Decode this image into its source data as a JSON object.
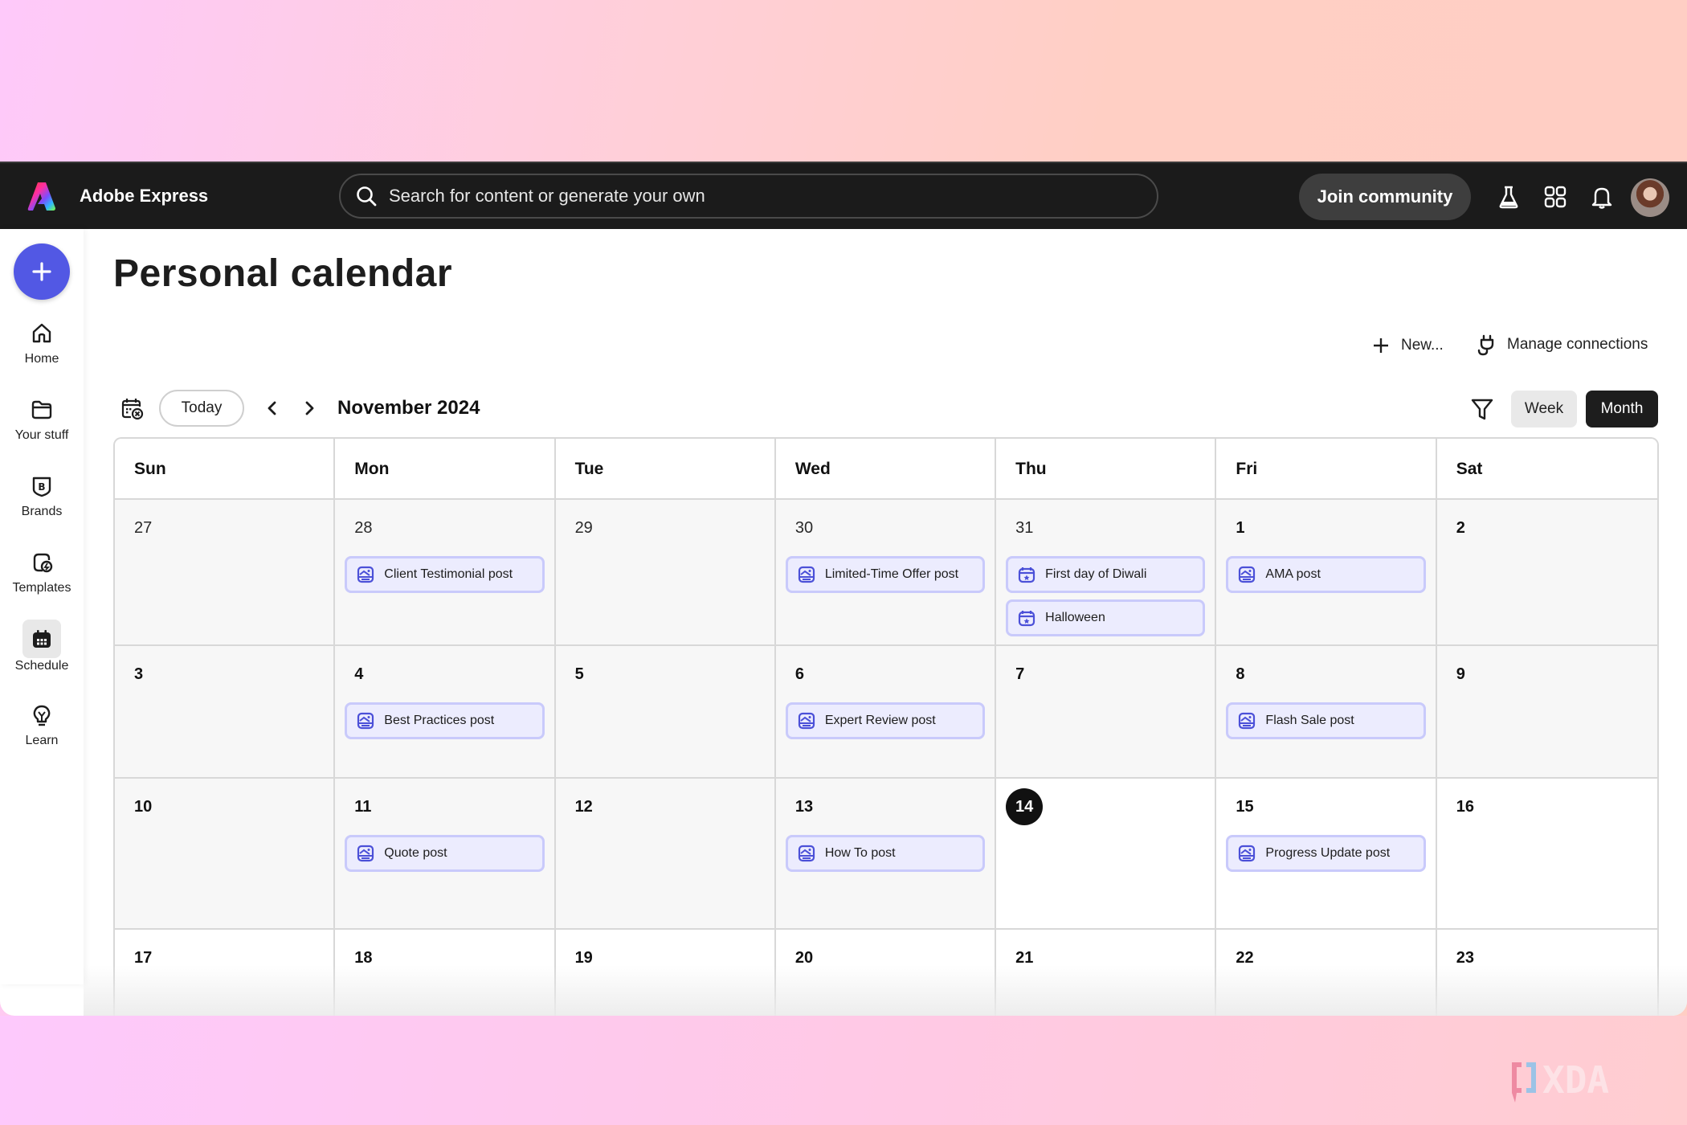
{
  "app": {
    "name": "Adobe Express",
    "search_placeholder": "Search for content or generate your own",
    "join_label": "Join community",
    "topbar_icons": [
      "labs-flask-icon",
      "apps-grid-icon",
      "notifications-bell-icon",
      "user-avatar"
    ]
  },
  "sidebar": {
    "create_icon": "plus-icon",
    "items": [
      {
        "label": "Home",
        "icon": "home-icon",
        "active": false
      },
      {
        "label": "Your stuff",
        "icon": "folder-icon",
        "active": false
      },
      {
        "label": "Brands",
        "icon": "brand-icon",
        "active": false
      },
      {
        "label": "Templates",
        "icon": "templates-icon",
        "active": false
      },
      {
        "label": "Schedule",
        "icon": "calendar-icon",
        "active": true
      },
      {
        "label": "Learn",
        "icon": "lightbulb-icon",
        "active": false
      }
    ]
  },
  "page": {
    "title": "Personal calendar",
    "new_label": "New...",
    "manage_label": "Manage connections"
  },
  "toolbar": {
    "today_label": "Today",
    "month_label": "November 2024",
    "week_label": "Week",
    "month_view_label": "Month",
    "active_view": "Month"
  },
  "calendar": {
    "weekdays": [
      "Sun",
      "Mon",
      "Tue",
      "Wed",
      "Thu",
      "Fri",
      "Sat"
    ],
    "today": "14",
    "weeks": [
      [
        {
          "day": "27",
          "other_month": true,
          "events": []
        },
        {
          "day": "28",
          "other_month": true,
          "events": [
            {
              "title": "Client Testimonial post",
              "type": "post"
            }
          ]
        },
        {
          "day": "29",
          "other_month": true,
          "events": []
        },
        {
          "day": "30",
          "other_month": true,
          "events": [
            {
              "title": "Limited-Time Offer post",
              "type": "post"
            }
          ]
        },
        {
          "day": "31",
          "other_month": true,
          "events": [
            {
              "title": "First day of Diwali",
              "type": "holiday"
            },
            {
              "title": "Halloween",
              "type": "holiday"
            }
          ]
        },
        {
          "day": "1",
          "other_month": false,
          "events": [
            {
              "title": "AMA post",
              "type": "post"
            }
          ]
        },
        {
          "day": "2",
          "other_month": false,
          "events": []
        }
      ],
      [
        {
          "day": "3",
          "other_month": false,
          "events": []
        },
        {
          "day": "4",
          "other_month": false,
          "events": [
            {
              "title": "Best Practices post",
              "type": "post"
            }
          ]
        },
        {
          "day": "5",
          "other_month": false,
          "events": []
        },
        {
          "day": "6",
          "other_month": false,
          "events": [
            {
              "title": "Expert Review post",
              "type": "post"
            }
          ]
        },
        {
          "day": "7",
          "other_month": false,
          "events": []
        },
        {
          "day": "8",
          "other_month": false,
          "events": [
            {
              "title": "Flash Sale post",
              "type": "post"
            }
          ]
        },
        {
          "day": "9",
          "other_month": false,
          "events": []
        }
      ],
      [
        {
          "day": "10",
          "other_month": false,
          "events": []
        },
        {
          "day": "11",
          "other_month": false,
          "events": [
            {
              "title": "Quote post",
              "type": "post"
            }
          ]
        },
        {
          "day": "12",
          "other_month": false,
          "events": []
        },
        {
          "day": "13",
          "other_month": false,
          "events": [
            {
              "title": "How To post",
              "type": "post"
            }
          ]
        },
        {
          "day": "14",
          "other_month": false,
          "events": []
        },
        {
          "day": "15",
          "other_month": false,
          "events": [
            {
              "title": "Progress Update post",
              "type": "post"
            }
          ]
        },
        {
          "day": "16",
          "other_month": false,
          "events": []
        }
      ],
      [
        {
          "day": "17",
          "other_month": false,
          "events": []
        },
        {
          "day": "18",
          "other_month": false,
          "events": []
        },
        {
          "day": "19",
          "other_month": false,
          "events": []
        },
        {
          "day": "20",
          "other_month": false,
          "events": []
        },
        {
          "day": "21",
          "other_month": false,
          "events": []
        },
        {
          "day": "22",
          "other_month": false,
          "events": []
        },
        {
          "day": "23",
          "other_month": false,
          "events": []
        }
      ]
    ]
  },
  "colors": {
    "accent": "#5258e4",
    "event_bg": "#ececfe",
    "event_border": "#c9cafb",
    "event_icon": "#4b50d8",
    "topbar_bg": "#1b1b1b"
  },
  "watermark": {
    "text": "XDA"
  }
}
